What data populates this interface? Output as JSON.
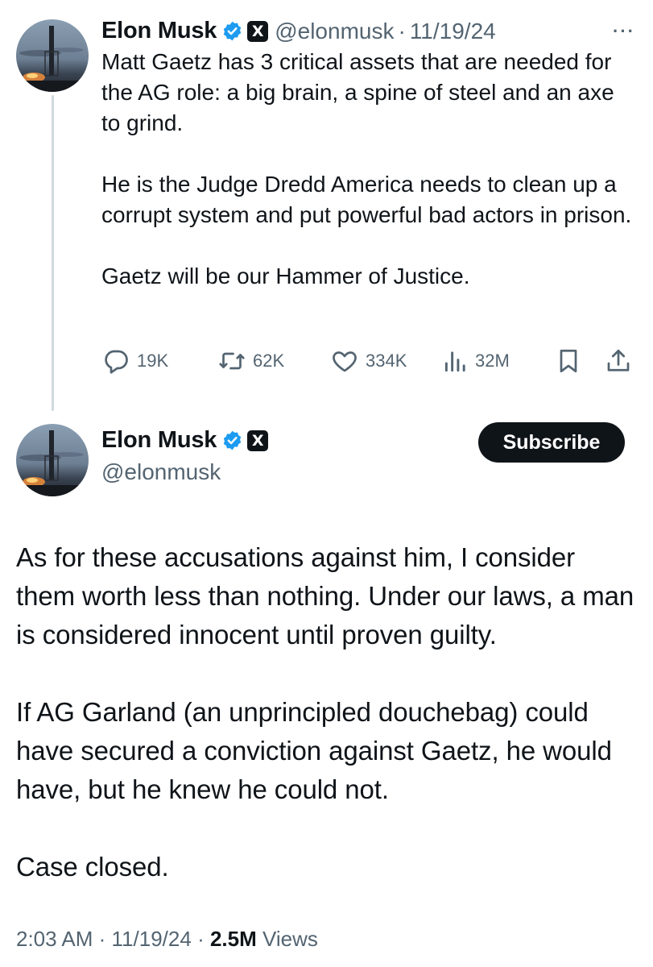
{
  "tweet1": {
    "author_name": "Elon Musk",
    "x_badge": "X",
    "handle": "@elonmusk",
    "separator": "·",
    "date": "11/19/24",
    "more": "···",
    "paragraphs": [
      "Matt Gaetz has 3 critical assets that are needed for the AG role: a big brain, a spine of steel and an axe to grind.",
      "He is the Judge Dredd America needs to clean up a corrupt system and put powerful bad actors in prison.",
      "Gaetz will be our Hammer of Justice."
    ],
    "stats": {
      "replies": "19K",
      "reposts": "62K",
      "likes": "334K",
      "views": "32M"
    }
  },
  "tweet2": {
    "author_name": "Elon Musk",
    "x_badge": "X",
    "handle": "@elonmusk",
    "subscribe_label": "Subscribe",
    "paragraphs": [
      "As for these accusations against him, I consider them worth less than nothing. Under our laws, a man is considered innocent until proven guilty.",
      "If AG Garland (an unprincipled douchebag) could have secured a conviction against Gaetz, he would have, but he knew he could not.",
      "Case closed."
    ],
    "time": "2:03 AM",
    "date": "11/19/24",
    "views_count": "2.5M",
    "views_label": "Views",
    "separator": "·"
  },
  "colors": {
    "text": "#0f1419",
    "secondary": "#536471",
    "verified": "#1d9bf0",
    "thread_line": "#cfd9de"
  }
}
